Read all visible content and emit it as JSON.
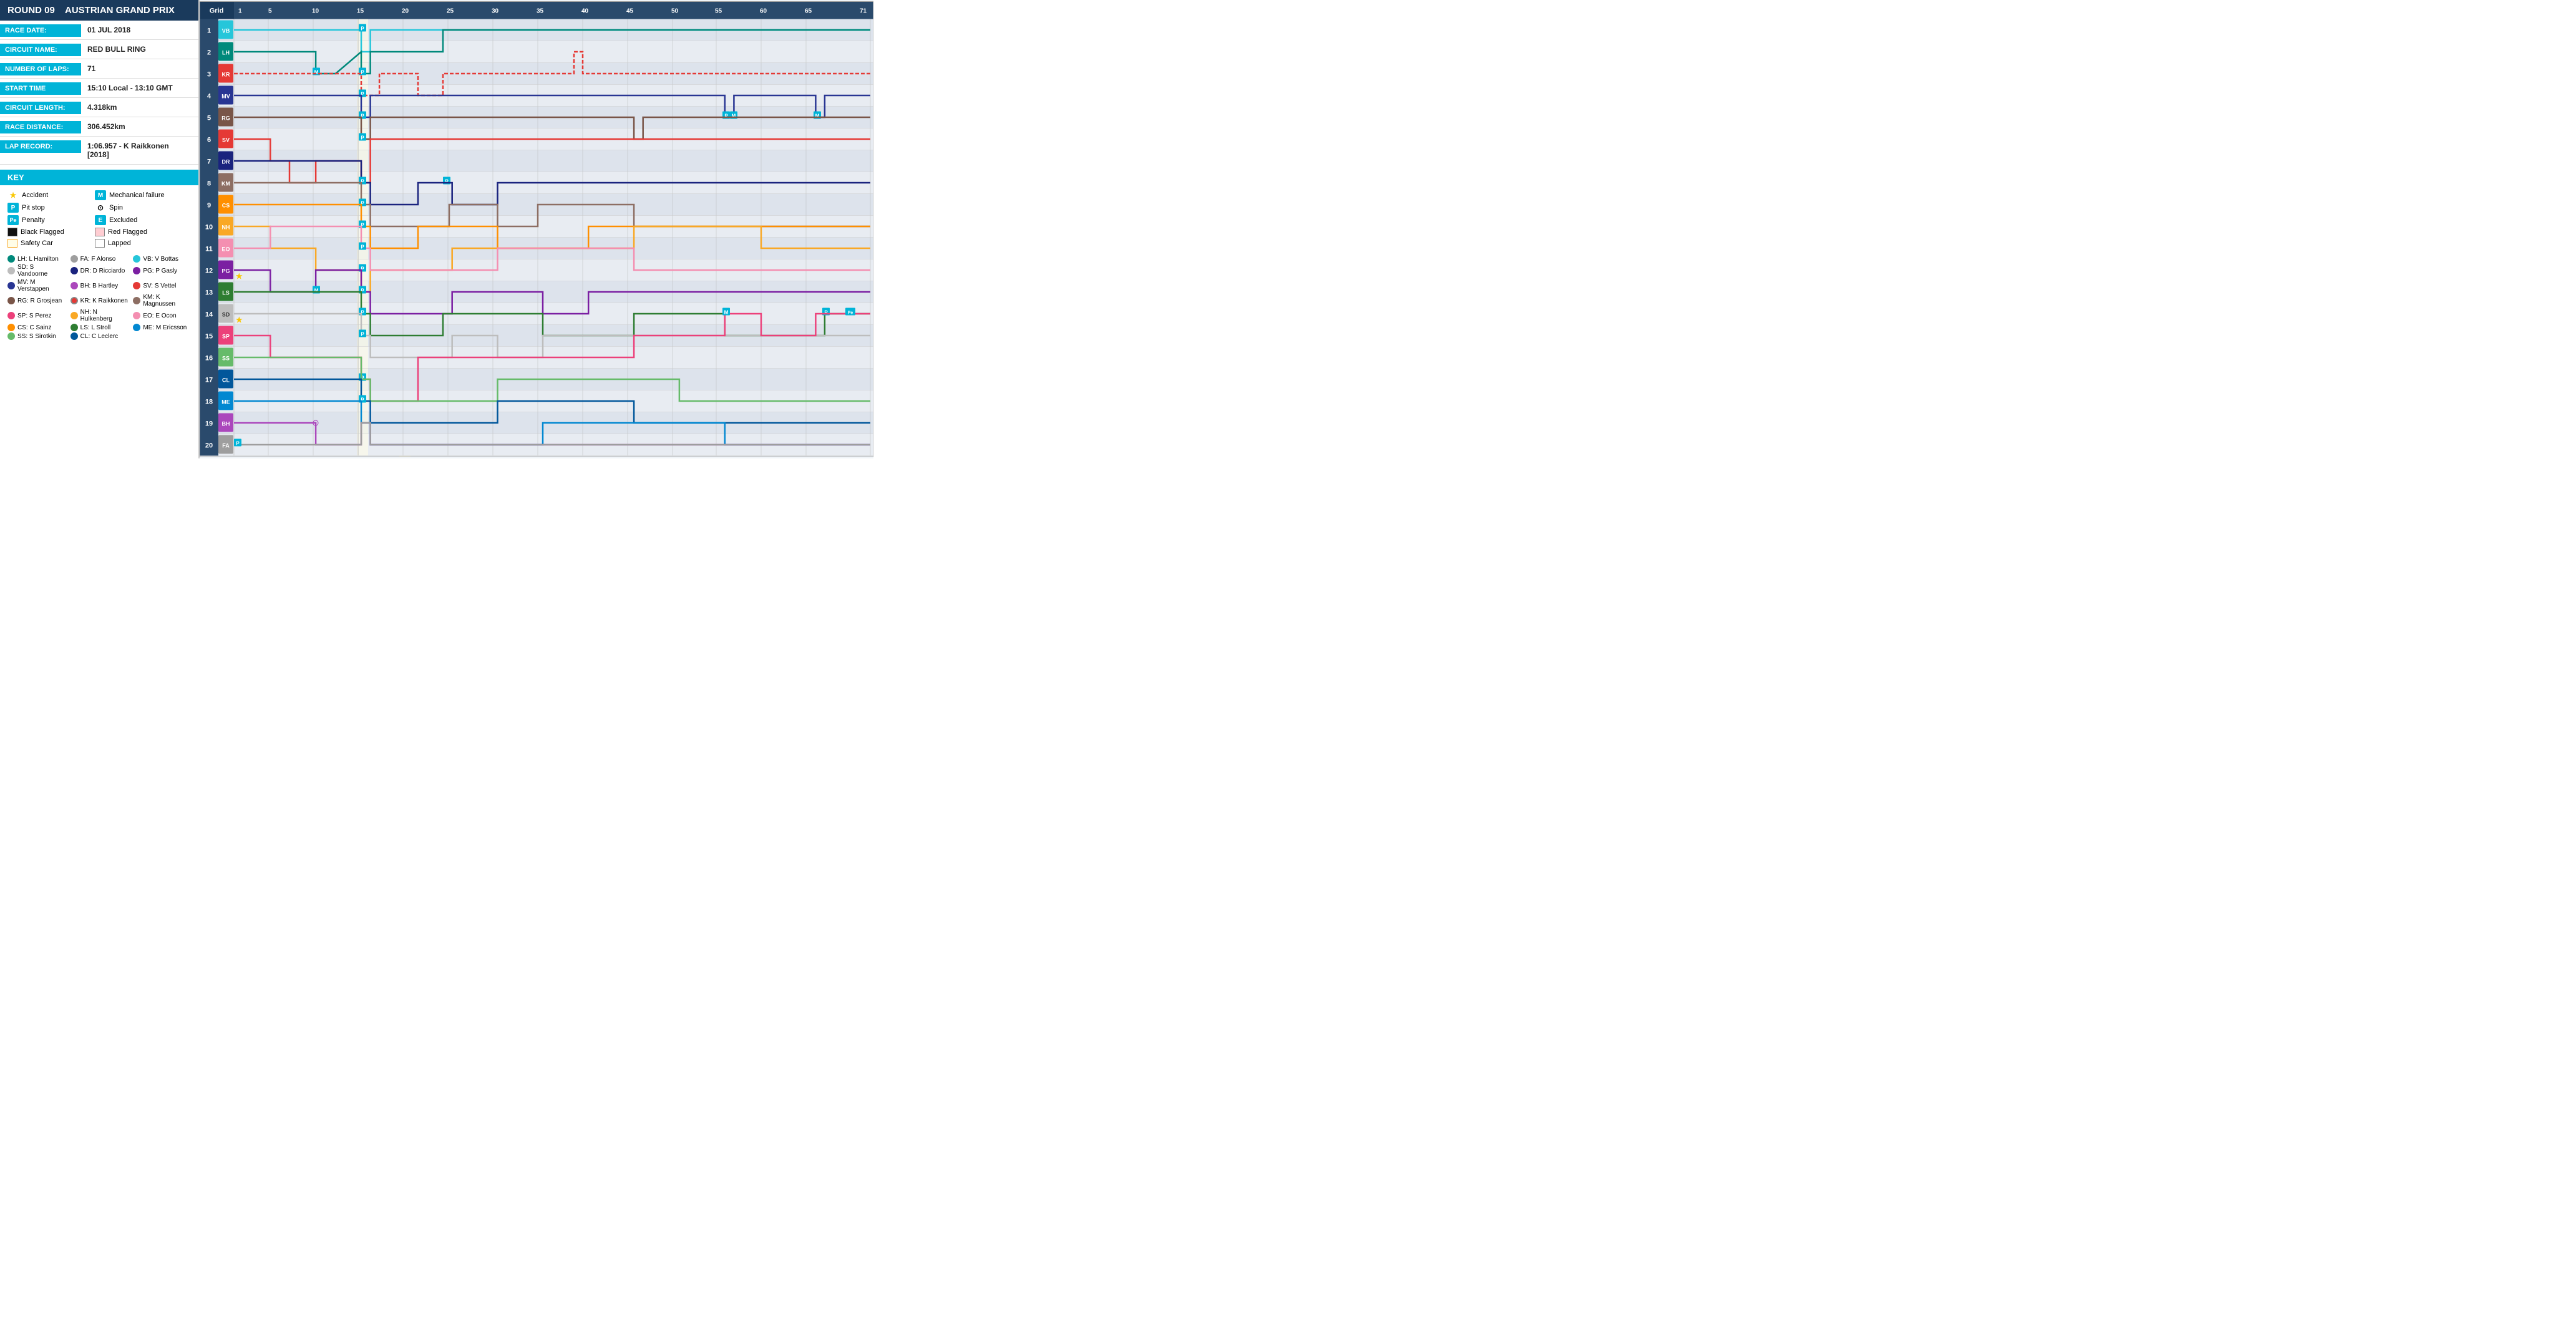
{
  "round": "ROUND 09",
  "race_name": "AUSTRIAN GRAND PRIX",
  "race_date_label": "RACE DATE:",
  "race_date_value": "01 JUL 2018",
  "circuit_name_label": "CIRCUIT NAME:",
  "circuit_name_value": "RED BULL RING",
  "num_laps_label": "NUMBER OF LAPS:",
  "num_laps_value": "71",
  "start_time_label": "START TIME",
  "start_time_value": "15:10 Local - 13:10 GMT",
  "circuit_length_label": "CIRCUIT LENGTH:",
  "circuit_length_value": "4.318km",
  "race_distance_label": "RACE DISTANCE:",
  "race_distance_value": "306.452km",
  "lap_record_label": "LAP RECORD:",
  "lap_record_value": "1:06.957 - K Raikkonen [2018]",
  "key_title": "KEY",
  "key_items": [
    {
      "symbol": "★",
      "label": "Accident",
      "type": "star"
    },
    {
      "symbol": "M",
      "label": "Mechanical failure",
      "type": "letter",
      "color": "#00b4d8"
    },
    {
      "symbol": "P",
      "label": "Pit stop",
      "type": "letter",
      "color": "#00b4d8"
    },
    {
      "symbol": "⊙",
      "label": "Spin",
      "type": "unicode"
    },
    {
      "symbol": "Pe",
      "label": "Penalty",
      "type": "letter",
      "color": "#00b4d8"
    },
    {
      "symbol": "E",
      "label": "Excluded",
      "type": "letter",
      "color": "#00b4d8"
    },
    {
      "symbol": "■",
      "label": "Black Flagged",
      "type": "box-black"
    },
    {
      "symbol": "▪",
      "label": "Red Flagged",
      "type": "box-red"
    },
    {
      "symbol": "□",
      "label": "Safety Car",
      "type": "box-yellow"
    },
    {
      "symbol": "□",
      "label": "Lapped",
      "type": "box-white"
    }
  ],
  "drivers": [
    {
      "abbr": "LH",
      "name": "L Hamilton",
      "color": "#00897b"
    },
    {
      "abbr": "VB",
      "name": "V Bottas",
      "color": "#26c6da"
    },
    {
      "abbr": "DR",
      "name": "D Ricciardo",
      "color": "#1a237e"
    },
    {
      "abbr": "MV",
      "name": "M Verstappen",
      "color": "#283593"
    },
    {
      "abbr": "SV",
      "name": "S Vettel",
      "color": "#e53935"
    },
    {
      "abbr": "KR",
      "name": "K Raikkonen",
      "color": "#e53935"
    },
    {
      "abbr": "SP",
      "name": "S Perez",
      "color": "#ec407a"
    },
    {
      "abbr": "EO",
      "name": "E Ocon",
      "color": "#f48fb1"
    },
    {
      "abbr": "LS",
      "name": "L Stroll",
      "color": "#2e7d32"
    },
    {
      "abbr": "SS",
      "name": "S Sirotkin",
      "color": "#66bb6a"
    },
    {
      "abbr": "FA",
      "name": "F Alonso",
      "color": "#9e9e9e"
    },
    {
      "abbr": "SD",
      "name": "S Vandoorne",
      "color": "#bdbdbd"
    },
    {
      "abbr": "PG",
      "name": "P Gasly",
      "color": "#7b1fa2"
    },
    {
      "abbr": "BH",
      "name": "B Hartley",
      "color": "#ab47bc"
    },
    {
      "abbr": "RG",
      "name": "R Grosjean",
      "color": "#5d4037"
    },
    {
      "abbr": "KM",
      "name": "K Magnussen",
      "color": "#8d6e63"
    },
    {
      "abbr": "NH",
      "name": "N Hulkenberg",
      "color": "#f9a825"
    },
    {
      "abbr": "CS",
      "name": "C Sainz",
      "color": "#ff8f00"
    },
    {
      "abbr": "ME",
      "name": "M Ericsson",
      "color": "#0288d1"
    },
    {
      "abbr": "CL",
      "name": "C Leclerc",
      "color": "#01579b"
    }
  ],
  "chart": {
    "total_laps": 71,
    "grid_positions": [
      1,
      2,
      3,
      4,
      5,
      6,
      7,
      8,
      9,
      10,
      11,
      12,
      13,
      14,
      15,
      16,
      17,
      18,
      19,
      20
    ],
    "lap_markers": [
      1,
      5,
      10,
      15,
      20,
      25,
      30,
      35,
      40,
      45,
      50,
      55,
      60,
      65,
      71
    ]
  }
}
